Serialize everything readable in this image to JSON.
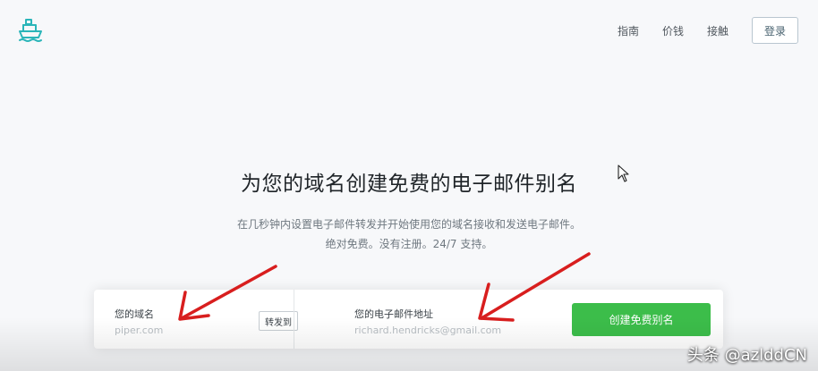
{
  "header": {
    "logo_icon": "ship-logo-icon",
    "nav": {
      "guide": "指南",
      "pricing": "价钱",
      "contact": "接触",
      "login": "登录"
    }
  },
  "hero": {
    "title": "为您的域名创建免费的电子邮件别名",
    "subtitle_line1": "在几秒钟内设置电子邮件转发并开始使用您的域名接收和发送电子邮件。",
    "subtitle_line2": "绝对免费。没有注册。24/7 支持。"
  },
  "form": {
    "domain_label": "您的域名",
    "domain_value": "",
    "domain_placeholder": "piper.com",
    "forward_tag": "转发到",
    "email_label": "您的电子邮件地址",
    "email_value": "",
    "email_placeholder": "richard.hendricks@gmail.com",
    "submit_label": "创建免费别名"
  },
  "colors": {
    "accent_green": "#3cbd4a",
    "logo_teal": "#2bb5b9",
    "arrow_red": "#d81e1e",
    "page_bg": "#f7f8fa"
  },
  "watermark": "头条 @azlddCN"
}
